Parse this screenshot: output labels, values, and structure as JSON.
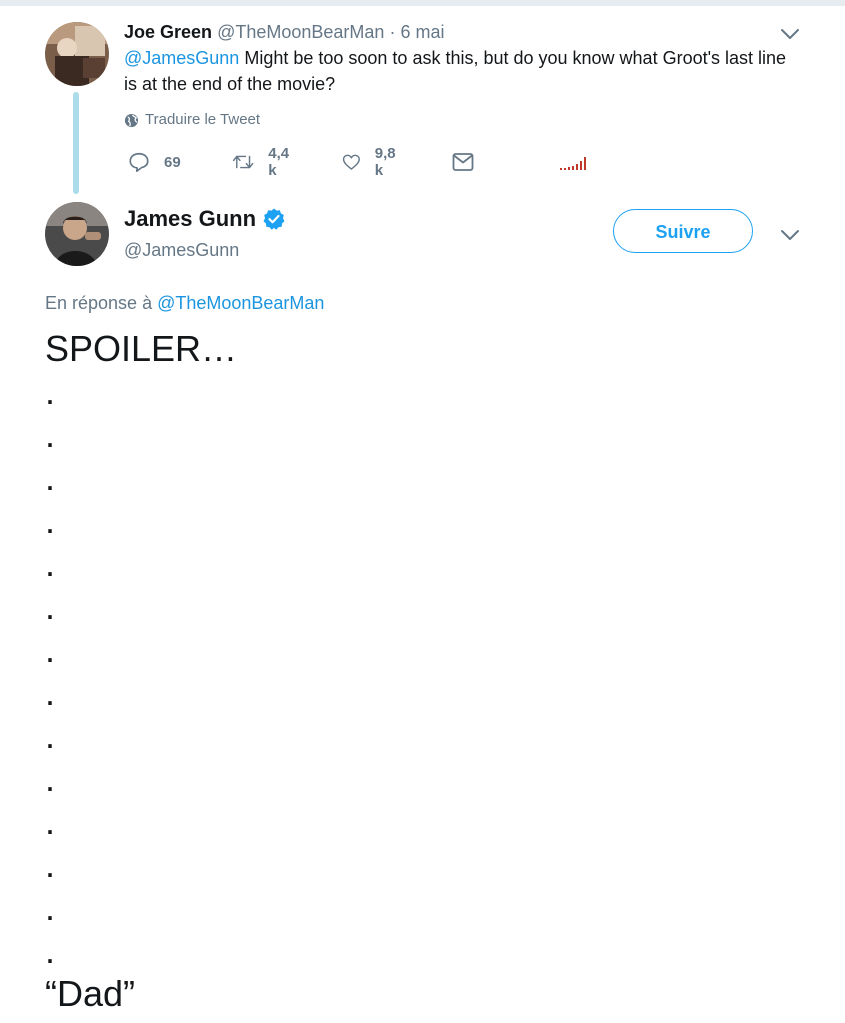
{
  "parent_tweet": {
    "name": "Joe Green",
    "handle": "@TheMoonBearMan",
    "separator": "·",
    "date": "6 mai",
    "mention": "@JamesGunn",
    "text": " Might be too soon to ask this, but do you know what Groot's last line is at the end of the movie?",
    "translate_label": "Traduire le Tweet",
    "actions": {
      "replies": "69",
      "retweets": "4,4 k",
      "likes": "9,8 k"
    }
  },
  "main_tweet": {
    "name": "James Gunn",
    "verified": true,
    "handle": "@JamesGunn",
    "follow_label": "Suivre",
    "reply_prefix": "En réponse à ",
    "reply_to": "@TheMoonBearMan",
    "body": "SPOILER…\n.\n.\n.\n.\n.\n.\n.\n.\n.\n.\n.\n.\n.\n.\n“Dad”"
  },
  "colors": {
    "accent": "#1da1f2",
    "link": "#1b95e0",
    "muted_text": "#657786",
    "thread_line": "#abdcea",
    "analytics": "#c0392b"
  },
  "icons": [
    "translate-globe-icon",
    "reply-icon",
    "retweet-icon",
    "like-icon",
    "direct-message-icon",
    "analytics-icon",
    "verified-badge-icon",
    "chevron-down-icon"
  ]
}
